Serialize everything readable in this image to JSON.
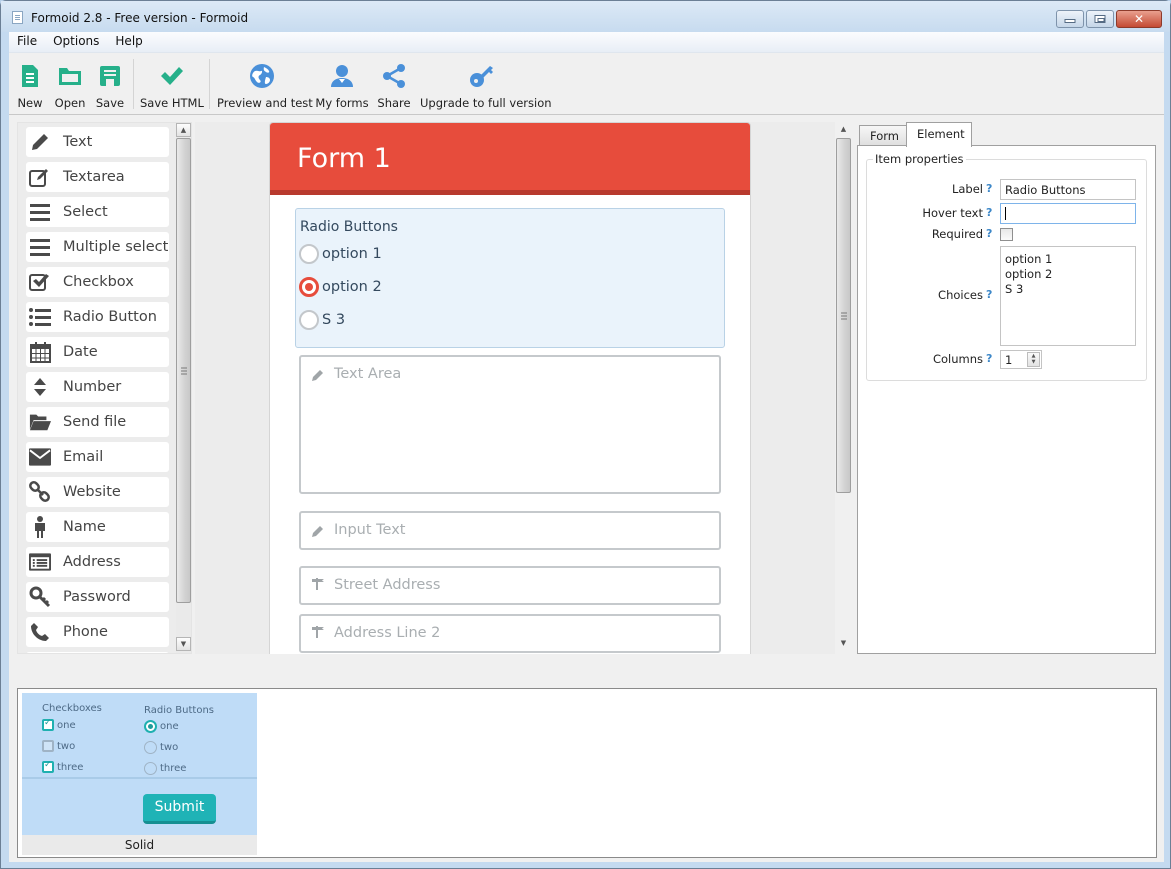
{
  "window": {
    "title": "Formoid 2.8 - Free version - Formoid",
    "controls": [
      "minimize",
      "maximize",
      "close"
    ]
  },
  "menubar": {
    "items": [
      "File",
      "Options",
      "Help"
    ]
  },
  "toolbar": {
    "buttons": [
      {
        "label": "New",
        "icon": "new-file-icon",
        "color": "#26b08a"
      },
      {
        "label": "Open",
        "icon": "folder-open-icon",
        "color": "#26b08a"
      },
      {
        "label": "Save",
        "icon": "floppy-save-icon",
        "color": "#26b08a"
      },
      {
        "label": "Save HTML",
        "icon": "checkmark-icon",
        "color": "#26b08a"
      },
      {
        "label": "Preview and test",
        "icon": "globe-icon",
        "color": "#4a90d9"
      },
      {
        "label": "My forms",
        "icon": "user-icon",
        "color": "#4a90d9"
      },
      {
        "label": "Share",
        "icon": "share-icon",
        "color": "#4a90d9"
      },
      {
        "label": "Upgrade to full version",
        "icon": "key-icon",
        "color": "#4a90d9"
      }
    ]
  },
  "palette": {
    "items": [
      {
        "label": "Text",
        "icon": "pencil-icon"
      },
      {
        "label": "Textarea",
        "icon": "edit-box-icon"
      },
      {
        "label": "Select",
        "icon": "lines-icon"
      },
      {
        "label": "Multiple select",
        "icon": "lines-icon"
      },
      {
        "label": "Checkbox",
        "icon": "checkbox-icon"
      },
      {
        "label": "Radio Button",
        "icon": "list-bullets-icon"
      },
      {
        "label": "Date",
        "icon": "calendar-icon"
      },
      {
        "label": "Number",
        "icon": "sort-arrows-icon"
      },
      {
        "label": "Send file",
        "icon": "folder-icon"
      },
      {
        "label": "Email",
        "icon": "envelope-icon"
      },
      {
        "label": "Website",
        "icon": "link-icon"
      },
      {
        "label": "Name",
        "icon": "person-icon"
      },
      {
        "label": "Address",
        "icon": "address-card-icon"
      },
      {
        "label": "Password",
        "icon": "key-icon"
      },
      {
        "label": "Phone",
        "icon": "phone-icon"
      }
    ]
  },
  "form": {
    "title": "Form 1",
    "accent_color": "#e74c3c",
    "radio_group": {
      "label": "Radio Buttons",
      "options": [
        {
          "label": "option 1",
          "checked": false
        },
        {
          "label": "option 2",
          "checked": true
        },
        {
          "label": "S 3",
          "checked": false
        }
      ]
    },
    "fields": [
      {
        "placeholder": "Text Area",
        "type": "textarea",
        "icon": "pencil-icon"
      },
      {
        "placeholder": "Input Text",
        "type": "text",
        "icon": "pencil-icon"
      },
      {
        "placeholder": "Street Address",
        "type": "text",
        "icon": "signpost-icon"
      },
      {
        "placeholder": "Address Line 2",
        "type": "text",
        "icon": "signpost-icon"
      }
    ]
  },
  "properties": {
    "tabs": [
      {
        "label": "Form",
        "active": false
      },
      {
        "label": "Element",
        "active": true
      }
    ],
    "group_title": "Item properties",
    "help_glyph": "?",
    "label": {
      "caption": "Label",
      "value": "Radio Buttons"
    },
    "hover_text": {
      "caption": "Hover text",
      "value": ""
    },
    "required": {
      "caption": "Required",
      "checked": false
    },
    "choices": {
      "caption": "Choices",
      "values": [
        "option 1",
        "option 2",
        "S 3"
      ]
    },
    "columns": {
      "caption": "Columns",
      "value": "1"
    }
  },
  "color_swatches": [
    "#1abc9c",
    "#2ecc71",
    "#34495e",
    "#3498db",
    "#9b59b6",
    "#e74c3c",
    "#f39c12"
  ],
  "themes": [
    {
      "name": "Solid",
      "checkbox_title": "Checkboxes",
      "checkboxes": [
        {
          "label": "one",
          "checked": true
        },
        {
          "label": "two",
          "checked": false
        },
        {
          "label": "three",
          "checked": true
        }
      ],
      "radio_title": "Radio Buttons",
      "radios": [
        {
          "label": "one",
          "checked": true
        },
        {
          "label": "two",
          "checked": false
        },
        {
          "label": "three",
          "checked": false
        }
      ],
      "submit_label": "Submit"
    }
  ]
}
